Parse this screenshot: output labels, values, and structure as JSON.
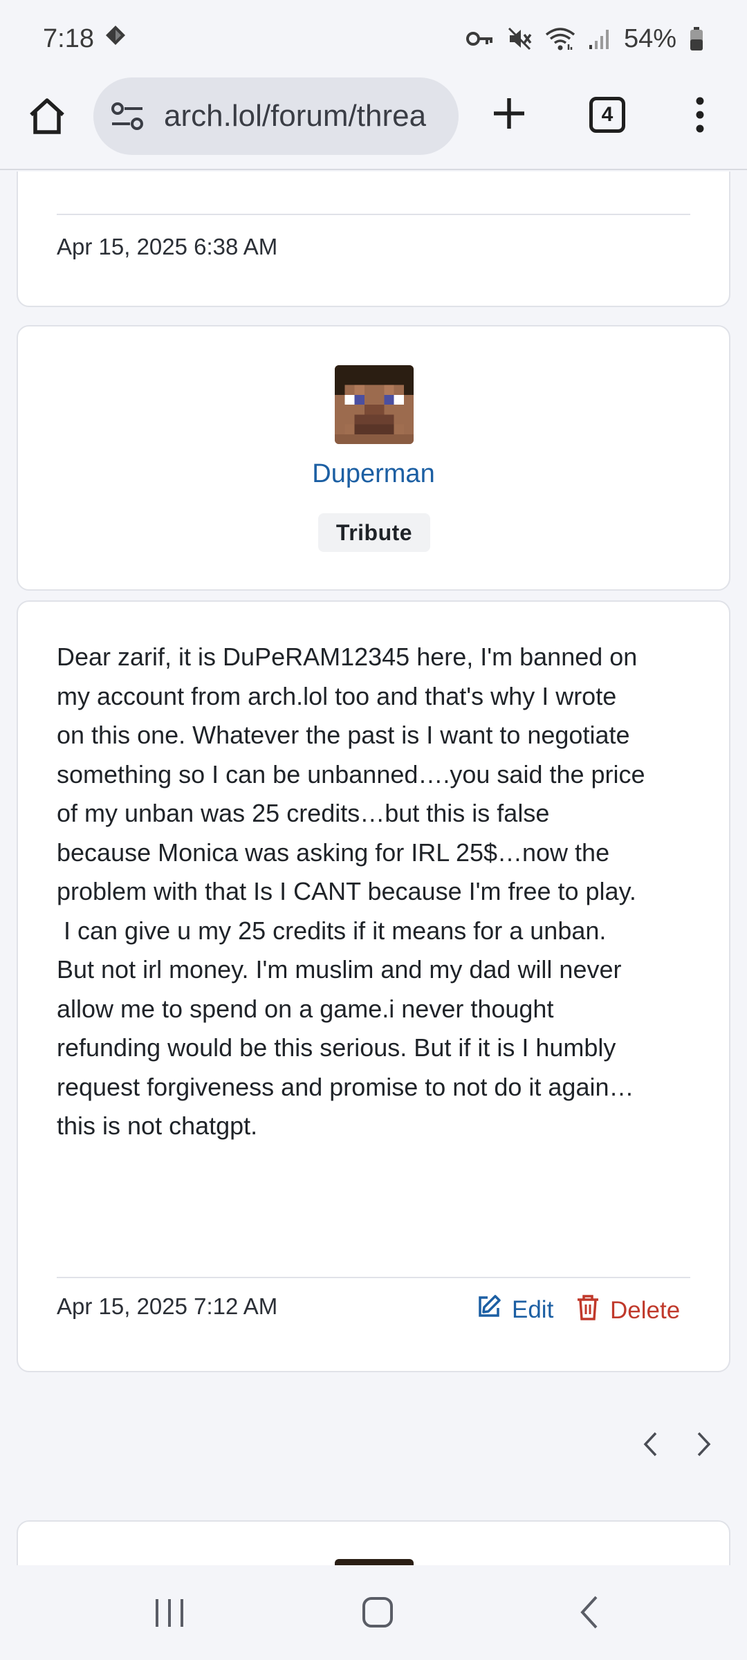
{
  "status_bar": {
    "time": "7:18",
    "battery": "54%",
    "icons": [
      "notification-diamond-icon",
      "vpn-key-icon",
      "mute-icon",
      "wifi-icon",
      "signal-icon",
      "battery-icon"
    ]
  },
  "browser": {
    "url": "arch.lol/forum/threa",
    "tab_count": "4",
    "icons": [
      "home-icon",
      "site-settings-icon",
      "new-tab-plus-icon",
      "tab-switcher-icon",
      "overflow-menu-icon"
    ]
  },
  "previous_post": {
    "timestamp": "Apr 15, 2025 6:38 AM"
  },
  "author": {
    "username": "Duperman",
    "rank": "Tribute"
  },
  "post": {
    "lines": [
      "Dear zarif, it is DuPeRAM12345 here, I'm banned on",
      "my account from arch.lol too and that's why I wrote",
      "on this one. Whatever the past is I want to negotiate",
      "something so I can be unbanned….you said the price",
      "of my unban was 25 credits…but this is false",
      "because Monica was asking for IRL 25$…now the",
      "problem with that Is I CANT because I'm free to play.",
      " I can give u my 25 credits if it means for a unban.",
      "But not irl money. I'm muslim and my dad will never",
      "allow me to spend on a game.i never thought",
      "refunding would be this serious. But if it is I humbly",
      "request forgiveness and promise to not do it again…",
      "this is not chatgpt."
    ],
    "timestamp": "Apr 15, 2025 7:12 AM",
    "edit_label": "Edit",
    "delete_label": "Delete"
  },
  "colors": {
    "link": "#1c5fa3",
    "danger": "#c0392b",
    "background": "#f4f5f9",
    "card": "#ffffff"
  }
}
